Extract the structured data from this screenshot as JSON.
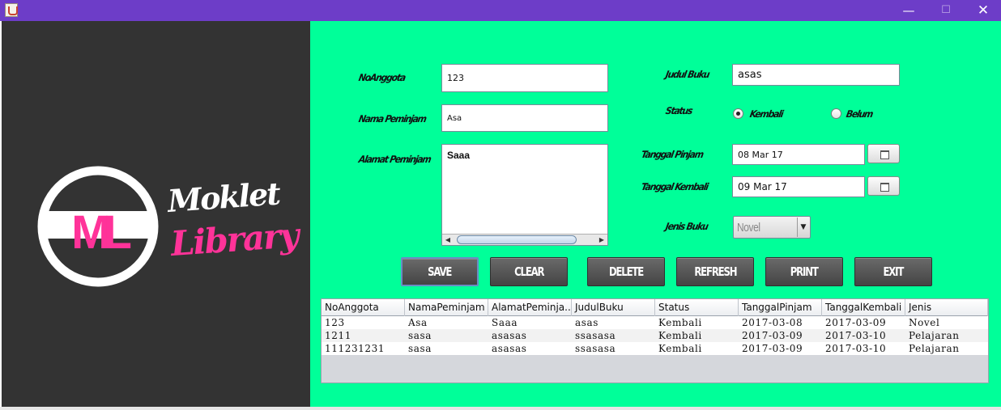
{
  "window": {
    "min_glyph": "—",
    "max_glyph": "☐",
    "close_glyph": "✕"
  },
  "colors": {
    "title_bar": "#6d3dc8",
    "left_panel": "#333333",
    "right_panel": "#00ff99",
    "logo_pink": "#ff3399",
    "button": "#555555"
  },
  "logo": {
    "monogram": "ML",
    "word1": "Moklet",
    "word2": "Library"
  },
  "form": {
    "no_anggota_label": "NoAnggota",
    "no_anggota_value": "123",
    "nama_label": "Nama Peminjam",
    "nama_value": "Asa",
    "alamat_label": "Alamat Peminjam",
    "alamat_value": "Saaa",
    "judul_label": "Judul Buku",
    "judul_value": "asas",
    "status_label": "Status",
    "status_options": [
      "Kembali",
      "Belum"
    ],
    "status_selected": "Kembali",
    "tanggal_pinjam_label": "Tanggal Pinjam",
    "tanggal_pinjam_value": "08 Mar 17",
    "tanggal_kembali_label": "Tanggal Kembali",
    "tanggal_kembali_value": "09 Mar 17",
    "jenis_label": "Jenis Buku",
    "jenis_value": "Novel",
    "calendar_icon": "calendar-icon"
  },
  "buttons": {
    "save": "SAVE",
    "clear": "CLEAR",
    "delete": "DELETE",
    "refresh": "REFRESH",
    "print": "PRINT",
    "exit": "EXIT"
  },
  "table": {
    "columns": [
      "NoAnggota",
      "NamaPeminjam",
      "AlamatPeminja...",
      "JudulBuku",
      "Status",
      "TanggalPinjam",
      "TanggalKembali",
      "Jenis"
    ],
    "rows": [
      [
        "123",
        "Asa",
        "Saaa",
        "asas",
        "Kembali",
        "2017-03-08",
        "2017-03-09",
        "Novel"
      ],
      [
        "1211",
        "sasa",
        "asasas",
        "ssasasa",
        "Kembali",
        "2017-03-09",
        "2017-03-10",
        "Pelajaran"
      ],
      [
        "111231231",
        "sasa",
        "asasas",
        "ssasasa",
        "Kembali",
        "2017-03-09",
        "2017-03-10",
        "Pelajaran"
      ]
    ]
  }
}
